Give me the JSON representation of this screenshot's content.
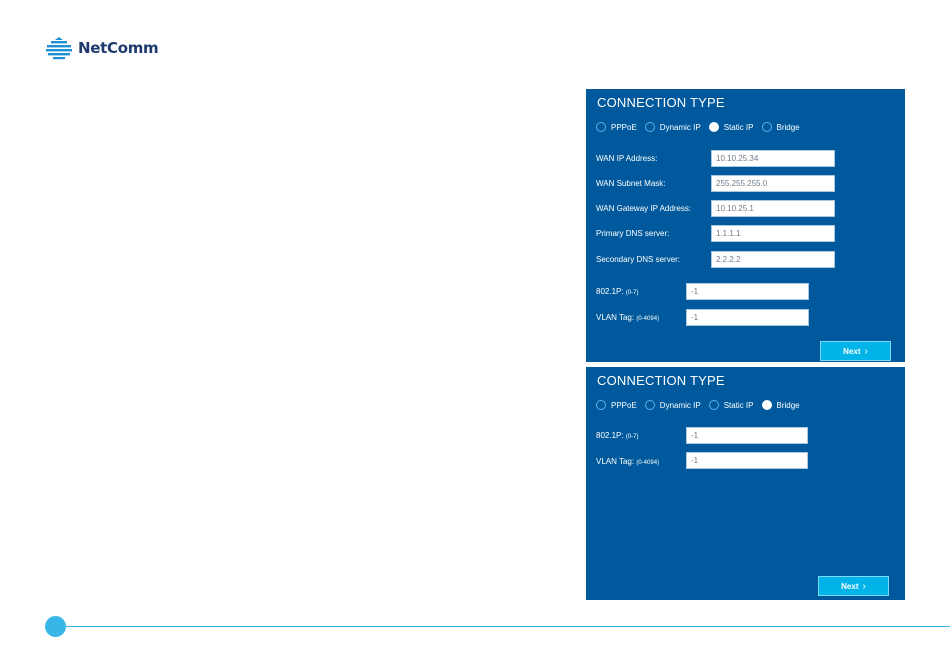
{
  "brand": {
    "name": "NetComm"
  },
  "panel1": {
    "title": "CONNECTION TYPE",
    "radios": [
      "PPPoE",
      "Dynamic IP",
      "Static IP",
      "Bridge"
    ],
    "selected": "Static IP",
    "fields": [
      {
        "label": "WAN IP Address:",
        "value": "10.10.25.34"
      },
      {
        "label": "WAN Subnet Mask:",
        "value": "255.255.255.0"
      },
      {
        "label": "WAN Gateway IP Address:",
        "value": "10.10.25.1"
      },
      {
        "label": "Primary DNS server:",
        "value": "1.1.1.1"
      },
      {
        "label": "Secondary DNS server:",
        "value": "2.2.2.2"
      }
    ],
    "p8021": {
      "label": "802.1P:",
      "range": "(0-7)",
      "value": "-1"
    },
    "vlan": {
      "label": "VLAN Tag:",
      "range": "(0-4094)",
      "value": "-1"
    },
    "next_label": "Next"
  },
  "panel2": {
    "title": "CONNECTION TYPE",
    "radios": [
      "PPPoE",
      "Dynamic IP",
      "Static IP",
      "Bridge"
    ],
    "selected": "Bridge",
    "p8021": {
      "label": "802.1P:",
      "range": "(0-7)",
      "value": "-1"
    },
    "vlan": {
      "label": "VLAN Tag:",
      "range": "(0-4094)",
      "value": "-1"
    },
    "next_label": "Next"
  },
  "colors": {
    "panel": "#00599c",
    "accent": "#00b4ea",
    "footer": "#39b6e8",
    "brand": "#1f3a6e"
  }
}
